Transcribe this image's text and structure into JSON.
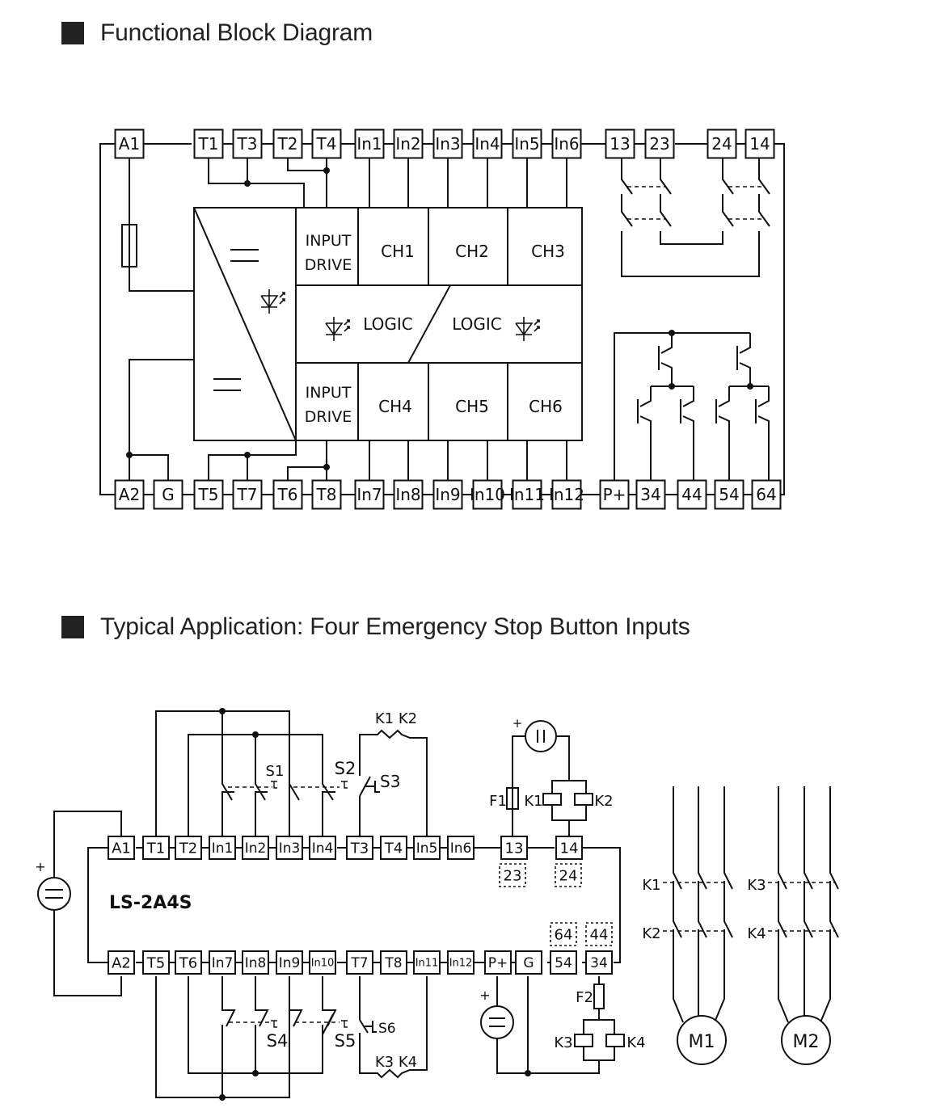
{
  "sections": [
    {
      "title": "Functional Block Diagram"
    },
    {
      "title": "Typical Application: Four Emergency Stop Button Inputs"
    }
  ],
  "block_diagram": {
    "top_terminals": [
      "A1",
      "T1",
      "T3",
      "T2",
      "T4",
      "In1",
      "In2",
      "In3",
      "In4",
      "In5",
      "In6",
      "13",
      "23",
      "24",
      "14"
    ],
    "bottom_terminals": [
      "A2",
      "G",
      "T5",
      "T7",
      "T6",
      "T8",
      "In7",
      "In8",
      "In9",
      "In10",
      "In11",
      "In12",
      "P+",
      "34",
      "44",
      "54",
      "64"
    ],
    "blocks": {
      "input_drive_top": [
        "INPUT",
        "DRIVE"
      ],
      "input_drive_bottom": [
        "INPUT",
        "DRIVE"
      ],
      "channels": [
        "CH1",
        "CH2",
        "CH3",
        "CH4",
        "CH5",
        "CH6"
      ],
      "logic_left": "LOGIC",
      "logic_right": "LOGIC"
    }
  },
  "application": {
    "device_label": "LS-2A4S",
    "top_terminals": [
      "A1",
      "T1",
      "T2",
      "In1",
      "In2",
      "In3",
      "In4",
      "T3",
      "T4",
      "In5",
      "In6",
      "13",
      "14"
    ],
    "top_alt_terminals": [
      "23",
      "24"
    ],
    "bottom_terminals": [
      "A2",
      "T5",
      "T6",
      "In7",
      "In8",
      "In9",
      "In10",
      "T7",
      "T8",
      "In11",
      "In12",
      "P+",
      "G",
      "54",
      "34"
    ],
    "bottom_alt_terminals": [
      "64",
      "44"
    ],
    "switch_labels": {
      "s1": "S1",
      "s2": "S2",
      "s3": "S3",
      "s4": "S4",
      "s5": "S5",
      "s6": "S6"
    },
    "contact_labels": {
      "k1k2": "K1 K2",
      "k3k4": "K3 K4"
    },
    "fuse_labels": {
      "f1": "F1",
      "f2": "F2"
    },
    "coil_labels": {
      "k1": "K1",
      "k2": "K2",
      "k3": "K3",
      "k4": "K4"
    },
    "plus_sign": "+",
    "motor_contacts": {
      "m1_upper": "K1",
      "m1_lower": "K2",
      "m2_upper": "K3",
      "m2_lower": "K4"
    },
    "motors": {
      "m1": "M1",
      "m2": "M2"
    }
  }
}
